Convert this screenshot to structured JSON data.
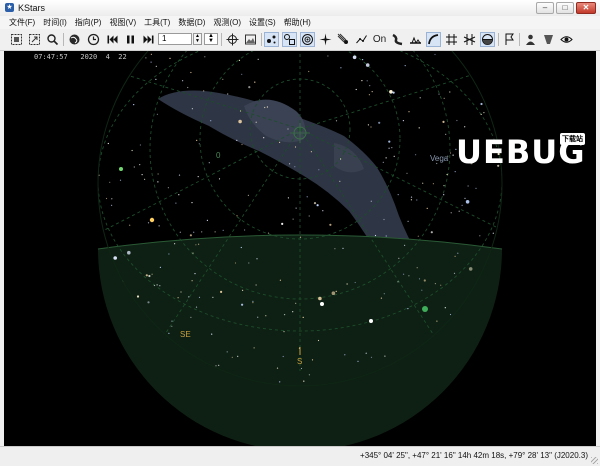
{
  "window": {
    "title": "KStars",
    "app_icon": "kstars-app-icon",
    "buttons": {
      "minimize": "–",
      "maximize": "□",
      "close": "✕"
    }
  },
  "menu": [
    "文件(F)",
    "时间(I)",
    "指向(P)",
    "视图(V)",
    "工具(T)",
    "数据(D)",
    "观测(O)",
    "设置(S)",
    "帮助(H)"
  ],
  "toolbar": {
    "time_step_value": "1",
    "icons": [
      "new-window-icon",
      "zoom-fit-icon",
      "find-icon",
      "globe-location-icon",
      "clock-icon",
      "step-back-icon",
      "pause-icon",
      "step-forward-icon",
      "crosshair-icon",
      "fov-image-icon",
      "stars-icon",
      "deep-sky-icon",
      "solar-system-icon",
      "supernova-icon",
      "comet-icon",
      "constellation-lines-icon",
      "constellation-names-icon",
      "milky-way-icon",
      "ground-icon",
      "horizon-line-icon",
      "coordinate-grid-icon",
      "equator-grid-icon",
      "altaz-icon",
      "flag-icon",
      "observer-icon",
      "eye-icon"
    ]
  },
  "sky": {
    "clock": "07:47:57   2020  4  22",
    "labels": {
      "south": "S",
      "southeast": "SE",
      "zenith_marker": "0",
      "vega": "Vega"
    },
    "colors": {
      "background": "#000000",
      "ground": "#0e2013",
      "milky_way": "#2e3544",
      "grid": "#1d4d2c",
      "horizon_label": "#c8a040"
    }
  },
  "watermark": {
    "text": "UEBUG",
    "badge": "下载站"
  },
  "status": {
    "coordinates": "+345° 04' 25\", +47° 21' 16\"  14h 42m 18s, +79° 28' 13\" (J2020.3)"
  }
}
